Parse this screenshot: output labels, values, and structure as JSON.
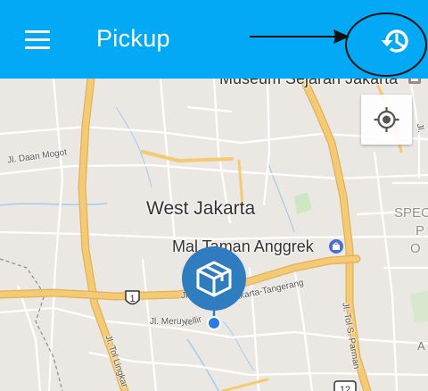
{
  "appbar": {
    "title": "Pickup",
    "bg_color": "#03a9f4",
    "menu_icon": "hamburger-menu-icon",
    "history_icon": "history-icon"
  },
  "map": {
    "labels": {
      "museum": "Museum Sejarah Jakarta",
      "west_jakarta": "West Jakarta",
      "mall": "Mal Taman Anggrek",
      "daan_mogot": "Jl. Daan Mogot",
      "tangerang": "Jakarta-Tangerang",
      "meruya": "Jl. Meruya",
      "tol_lingkar": "Jl. Tol Lingkar",
      "tol_parman": "Jl. Tol S. Parman",
      "spec_fragment": "SPEC",
      "o_fragment": "O",
      "p_fragment": "P",
      "jl_fragment": "Jl.",
      "a_fragment": "A",
      "ib_fragment": "Jl",
      "yellir": "Yellir"
    },
    "shields": {
      "route_1": "1",
      "route_12": "12"
    },
    "locate_icon": "my-location-icon"
  },
  "marker": {
    "icon": "package-box-icon",
    "color": "#2f7dbf",
    "dot_color": "#2c7be5"
  }
}
